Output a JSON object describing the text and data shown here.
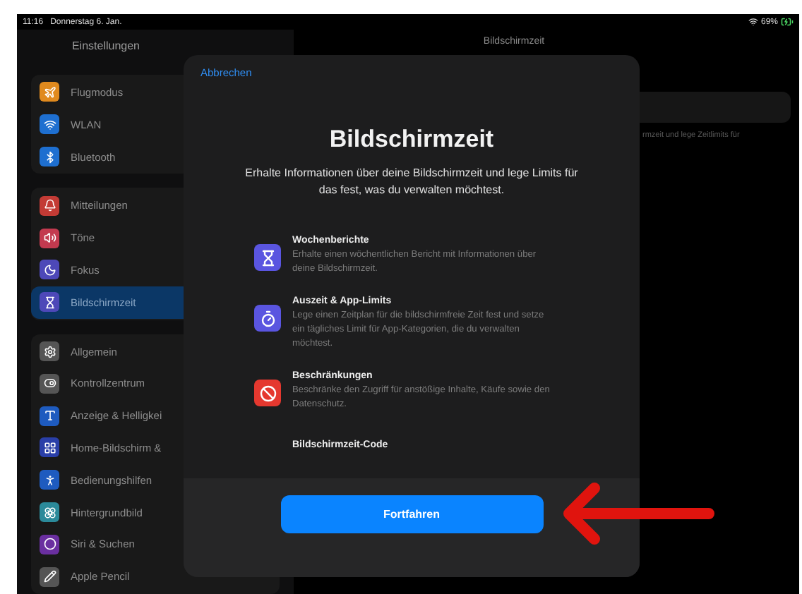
{
  "status_bar": {
    "time": "11:16",
    "date": "Donnerstag 6. Jan.",
    "battery": "69%"
  },
  "sidebar": {
    "title": "Einstellungen",
    "groups": [
      {
        "items": [
          {
            "label": "Flugmodus",
            "selected": false
          },
          {
            "label": "WLAN",
            "selected": false
          },
          {
            "label": "Bluetooth",
            "selected": false
          }
        ]
      },
      {
        "items": [
          {
            "label": "Mitteilungen",
            "selected": false
          },
          {
            "label": "Töne",
            "selected": false
          },
          {
            "label": "Fokus",
            "selected": false
          },
          {
            "label": "Bildschirmzeit",
            "selected": true
          }
        ]
      },
      {
        "items": [
          {
            "label": "Allgemein",
            "selected": false
          },
          {
            "label": "Kontrollzentrum",
            "selected": false
          },
          {
            "label": "Anzeige & Helligkei",
            "selected": false
          },
          {
            "label": "Home-Bildschirm &",
            "selected": false
          },
          {
            "label": "Bedienungshilfen",
            "selected": false
          },
          {
            "label": "Hintergrundbild",
            "selected": false
          },
          {
            "label": "Siri & Suchen",
            "selected": false
          },
          {
            "label": "Apple Pencil",
            "selected": false
          }
        ]
      }
    ]
  },
  "detail": {
    "title": "Bildschirmzeit",
    "note": "rmzeit und lege Zeitlimits für"
  },
  "modal": {
    "cancel": "Abbrechen",
    "title": "Bildschirmzeit",
    "subtitle": "Erhalte Informationen über deine Bildschirmzeit und lege Limits für das fest, was du verwalten möchtest.",
    "features": [
      {
        "kind": "report",
        "title": "Wochenberichte",
        "text": "Erhalte einen wöchentlichen Bericht mit Informationen über deine Bildschirmzeit."
      },
      {
        "kind": "downtime",
        "title": "Auszeit & App-Limits",
        "text": "Lege einen Zeitplan für die bildschirmfreie Zeit fest und setze ein tägliches Limit für App-Kategorien, die du verwalten möchtest."
      },
      {
        "kind": "restrictions",
        "title": "Beschränkungen",
        "text": "Beschränke den Zugriff für anstößige Inhalte, Käufe sowie den Datenschutz."
      },
      {
        "kind": "code",
        "title": "Bildschirmzeit-Code"
      }
    ],
    "button": "Fortfahren"
  }
}
